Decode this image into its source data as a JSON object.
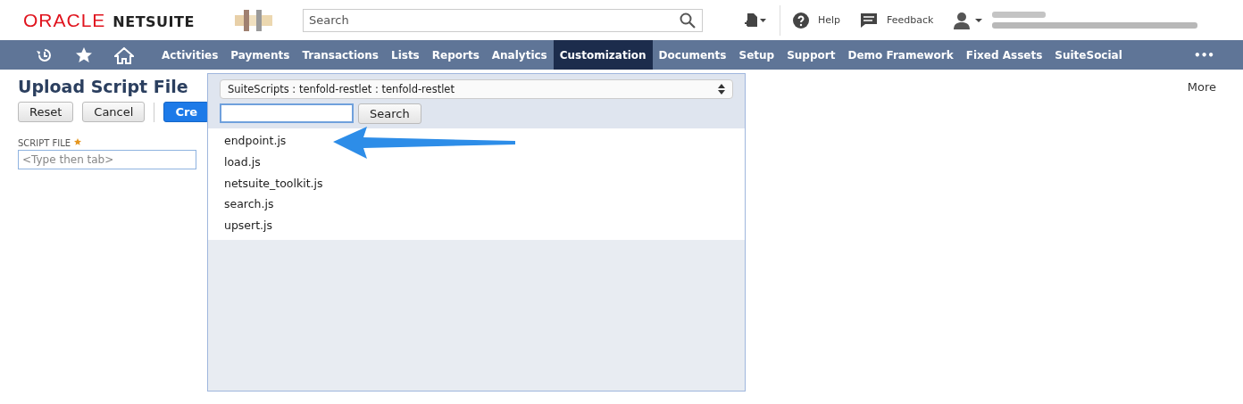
{
  "header": {
    "logo_brand": "ORACLE",
    "logo_product": "NETSUITE",
    "search": {
      "placeholder": "Search"
    },
    "help": "Help",
    "feedback": "Feedback"
  },
  "nav": {
    "items": [
      {
        "label": "Activities",
        "selected": false
      },
      {
        "label": "Payments",
        "selected": false
      },
      {
        "label": "Transactions",
        "selected": false
      },
      {
        "label": "Lists",
        "selected": false
      },
      {
        "label": "Reports",
        "selected": false
      },
      {
        "label": "Analytics",
        "selected": false
      },
      {
        "label": "Customization",
        "selected": true
      },
      {
        "label": "Documents",
        "selected": false
      },
      {
        "label": "Setup",
        "selected": false
      },
      {
        "label": "Support",
        "selected": false
      },
      {
        "label": "Demo Framework",
        "selected": false
      },
      {
        "label": "Fixed Assets",
        "selected": false
      },
      {
        "label": "SuiteSocial",
        "selected": false
      }
    ],
    "more": "•••"
  },
  "page": {
    "title": "Upload Script File",
    "more": "More",
    "buttons": [
      {
        "label": "Reset",
        "kind": "plain"
      },
      {
        "label": "Cancel",
        "kind": "plain"
      },
      {
        "label": "Cre",
        "kind": "primary"
      }
    ],
    "field": {
      "label": "SCRIPT FILE",
      "required": true,
      "placeholder": "<Type then tab>"
    }
  },
  "dropdown": {
    "folder": "SuiteScripts : tenfold-restlet : tenfold-restlet",
    "search_button": "Search",
    "files": [
      "endpoint.js",
      "load.js",
      "netsuite_toolkit.js",
      "search.js",
      "upsert.js"
    ]
  }
}
